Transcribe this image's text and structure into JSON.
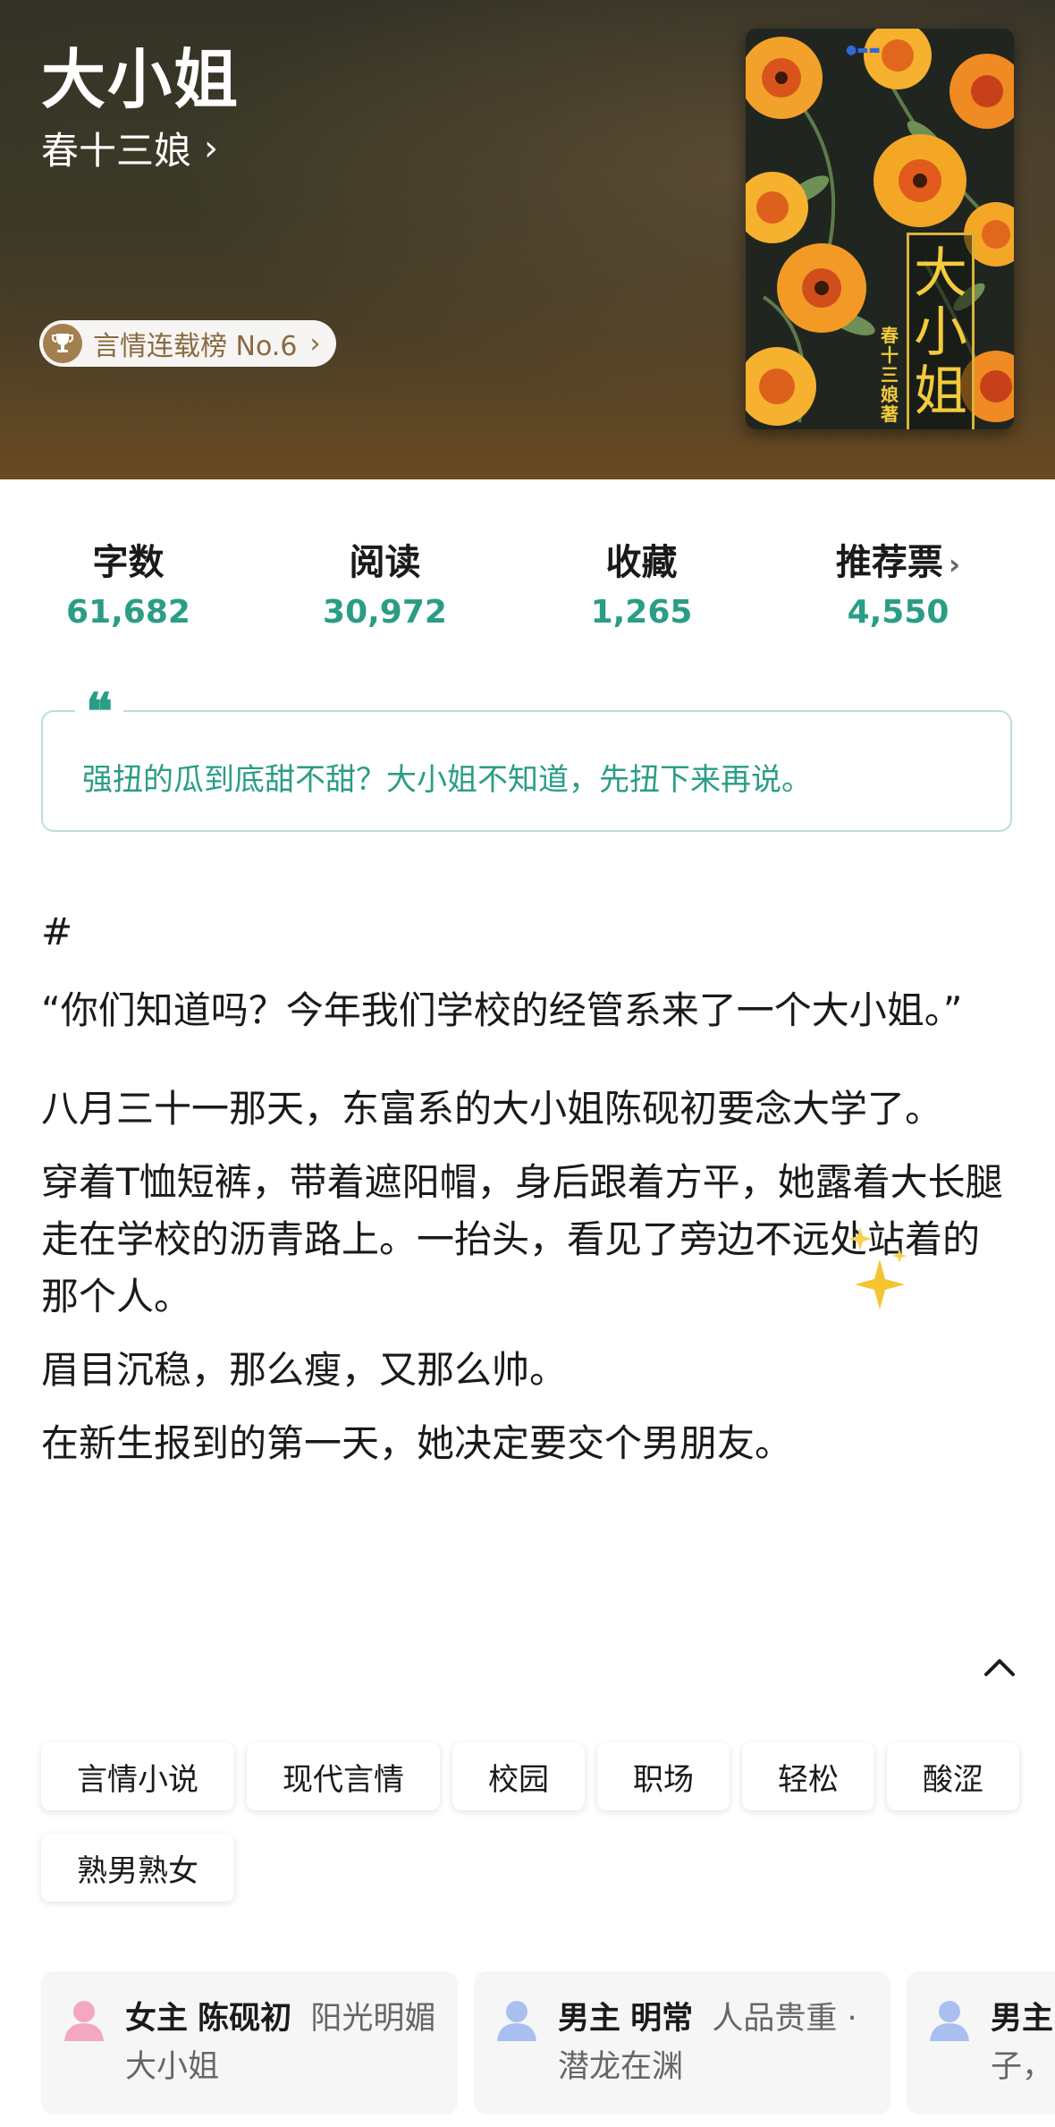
{
  "book": {
    "title": "大小姐",
    "author": "春十三娘",
    "rank_label": "言情连载榜 No.6",
    "cover": {
      "title_chars": [
        "大",
        "小",
        "姐"
      ],
      "author_chars": [
        "春",
        "十",
        "三",
        "娘",
        "著"
      ]
    }
  },
  "stats": [
    {
      "label": "字数",
      "value": "61,682"
    },
    {
      "label": "阅读",
      "value": "30,972"
    },
    {
      "label": "收藏",
      "value": "1,265"
    },
    {
      "label": "推荐票",
      "value": "4,550"
    }
  ],
  "quote": {
    "mark": "❝",
    "text": "强扭的瓜到底甜不甜？大小姐不知道，先扭下来再说。"
  },
  "synopsis": {
    "hash": "#",
    "paragraphs": [
      "“你们知道吗？今年我们学校的经管系来了一个大小姐。”",
      "八月三十一那天，东富系的大小姐陈砚初要念大学了。",
      "穿着T恤短裤，带着遮阳帽，身后跟着方平，她露着大长腿走在学校的沥青路上。一抬头，看见了旁边不远处站着的那个人。",
      "眉目沉稳，那么瘦，又那么帅。",
      "在新生报到的第一天，她决定要交个男朋友。"
    ]
  },
  "tags": [
    "言情小说",
    "现代言情",
    "校园",
    "职场",
    "轻松",
    "酸涩",
    "熟男熟女"
  ],
  "characters": [
    {
      "role": "女主",
      "name": "陈砚初",
      "desc": "阳光明媚大小姐",
      "avatar_color": "#f4a8c0"
    },
    {
      "role": "男主",
      "name": "明常",
      "desc": "人品贵重 · 潜龙在渊",
      "avatar_color": "#a9bff0"
    },
    {
      "role": "男主",
      "name": "",
      "desc": "子，",
      "avatar_color": "#a9bff0"
    }
  ],
  "colors": {
    "accent": "#2a9d85",
    "badge_text": "#8a6a40",
    "cover_title": "#f3cb3c"
  },
  "icons": {
    "chevron": "chevron-right-icon",
    "trophy": "trophy-icon",
    "collapse": "chevron-up-icon",
    "sparkle": "sparkle-icon",
    "avatar": "person-avatar-icon"
  }
}
